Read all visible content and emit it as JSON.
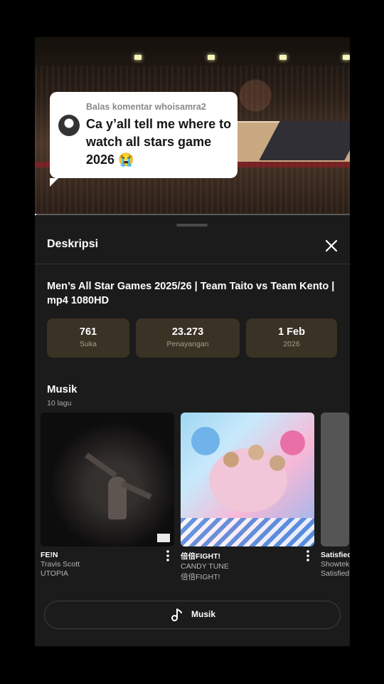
{
  "video": {
    "progress_percent": 0.5,
    "reply": {
      "heading": "Balas komentar whoisamra2",
      "text": "Ca y’all tell me where to watch all stars game 2026 😭"
    }
  },
  "sheet": {
    "title": "Deskripsi",
    "video_title": "Men’s All Star Games 2025/26 | Team Taito vs Team Kento | mp4 1080HD",
    "stats": [
      {
        "value": "761",
        "label": "Suka"
      },
      {
        "value": "23.273",
        "label": "Penayangan"
      },
      {
        "value": "1 Feb",
        "label": "2026"
      }
    ],
    "music": {
      "title": "Musik",
      "count": "10 lagu",
      "tracks": [
        {
          "title": "FE!N",
          "artist": "Travis Scott",
          "album": "UTOPIA"
        },
        {
          "title": "倍倍FIGHT!",
          "artist": "CANDY TUNE",
          "album": "倍倍FIGHT!"
        },
        {
          "title": "Satisfied",
          "artist": "Showtek",
          "album": "Satisfied"
        }
      ],
      "button_label": "Musik"
    }
  },
  "icons": {
    "close": "close-icon",
    "music": "music-note-icon",
    "more": "more-vertical-icon"
  },
  "colors": {
    "sheet_bg": "#1b1b1b",
    "stat_bg": "#3a3224"
  }
}
